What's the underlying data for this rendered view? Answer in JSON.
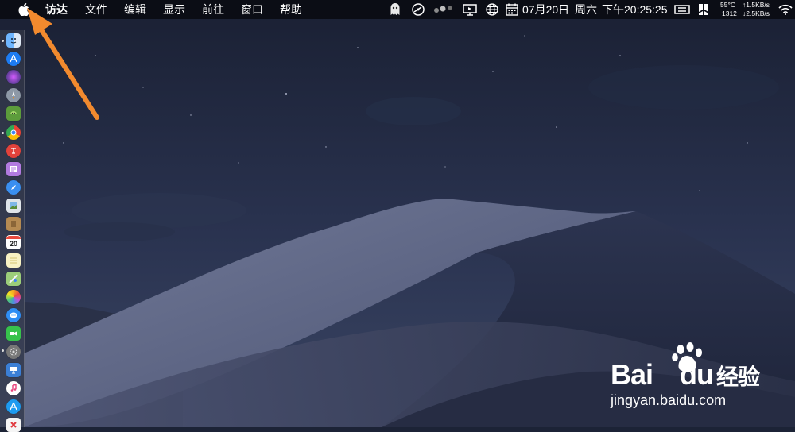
{
  "menubar": {
    "apple_icon": "apple-icon",
    "menus": [
      "访达",
      "文件",
      "编辑",
      "显示",
      "前往",
      "窗口",
      "帮助"
    ],
    "date": "07月20日",
    "weekday": "周六",
    "time": "下午20:25:25",
    "stats": {
      "temperature": "55°C",
      "fan": "1312",
      "upload": "↑1.5KB/s",
      "download": "↓2.5KB/s"
    }
  },
  "dock": {
    "calendar_day": "20",
    "items": [
      "finder-icon",
      "appstore-icon",
      "siri-icon",
      "launchpad-icon",
      "android-icon",
      "chrome-icon",
      "translate-icon",
      "pages-icon",
      "safari-icon",
      "preview-icon",
      "notebook-icon",
      "calendar-icon",
      "notes-icon",
      "maps-icon",
      "photos-icon",
      "messages-icon",
      "facetime-icon",
      "system-preferences-icon",
      "keynote-icon",
      "itunes-icon",
      "appstore-icon",
      "xmind-icon"
    ]
  },
  "watermark": {
    "brand_left": "Bai",
    "brand_right": "du",
    "brand_cn": "经验",
    "url": "jingyan.baidu.com"
  },
  "colors": {
    "annotation_arrow": "#f28a2e",
    "sky": "#1c2336",
    "dune": "#5a6281"
  }
}
